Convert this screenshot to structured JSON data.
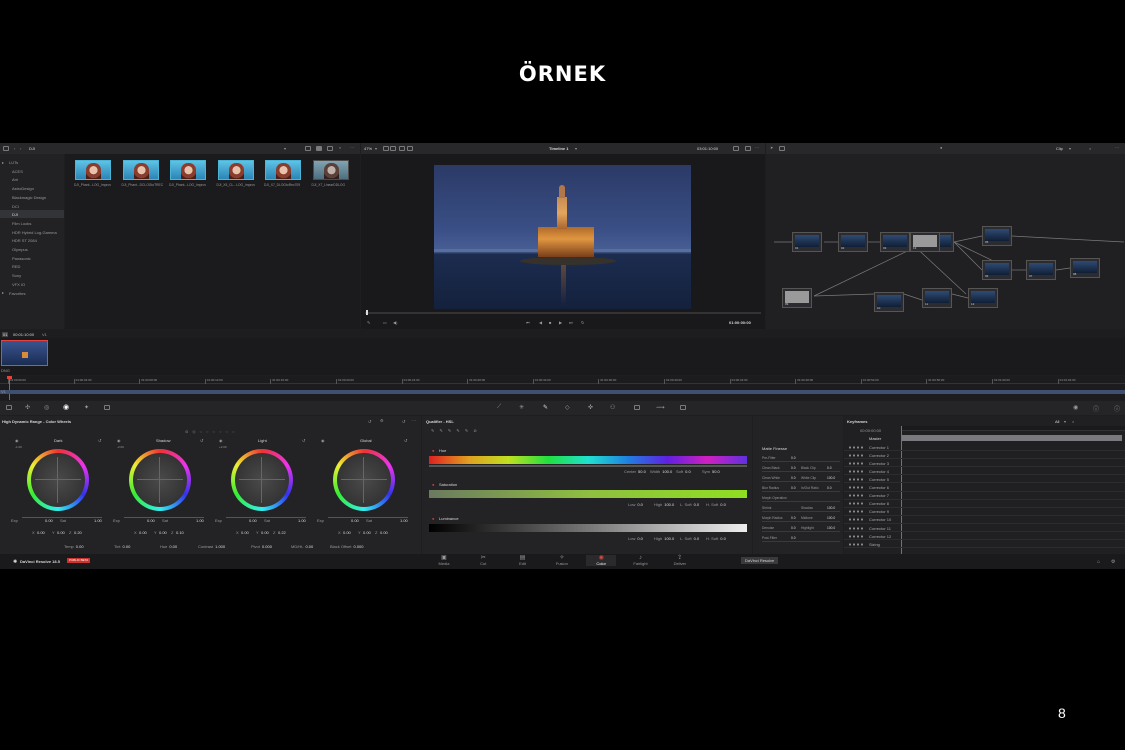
{
  "slide": {
    "title": "ÖRNEK",
    "page_number": "8"
  },
  "media_pool": {
    "path": "DJI",
    "tree": [
      {
        "label": "LUTs",
        "level": 0
      },
      {
        "label": "ACES",
        "level": 1
      },
      {
        "label": "Arri",
        "level": 1
      },
      {
        "label": "AstroDesign",
        "level": 1
      },
      {
        "label": "Blackmagic Design",
        "level": 1
      },
      {
        "label": "DCI",
        "level": 1
      },
      {
        "label": "DJI",
        "level": 1,
        "selected": true
      },
      {
        "label": "Film Looks",
        "level": 1
      },
      {
        "label": "HDR Hybrid Log-Gamma",
        "level": 1
      },
      {
        "label": "HDR ST 2084",
        "level": 1
      },
      {
        "label": "Olympus",
        "level": 1
      },
      {
        "label": "Panasonic",
        "level": 1
      },
      {
        "label": "RED",
        "level": 1
      },
      {
        "label": "Sony",
        "level": 1
      },
      {
        "label": "VFX IO",
        "level": 1
      },
      {
        "label": "Favorites",
        "level": 0
      }
    ],
    "thumbs": [
      "DJI_Phant...LOG_Improv",
      "DJI_Phant...DCLOGtoTREC",
      "DJI_Phant...LOG_Improv",
      "DJI_X5_CL...LOG_Improv",
      "DJI_X7_DLOGtoRec709",
      "DJI_X7_LinearDDLOG"
    ]
  },
  "viewer": {
    "zoom": "47%",
    "timeline_name": "Timeline 1",
    "timecode_top": "03:01:10:00",
    "timecode": "01:00:00:00"
  },
  "node_editor": {
    "mode": "Clip",
    "nodes": [
      "01",
      "02",
      "03",
      "04",
      "05",
      "06",
      "07",
      "08",
      "09",
      "10",
      "11",
      "12",
      "13"
    ]
  },
  "clips": {
    "clip_timecode": "00:01:10:00",
    "clip_label": "V1",
    "clip_format": "DNG"
  },
  "ruler": {
    "ticks": [
      "01:00:00:00",
      "01:00:04:00",
      "01:00:08:00",
      "01:00:12:00",
      "01:00:16:00",
      "01:00:20:00",
      "01:00:24:00",
      "01:00:28:00",
      "01:00:32:00",
      "01:00:36:00",
      "01:00:40:00",
      "01:00:44:00",
      "01:00:48:00",
      "01:00:52:00",
      "01:00:56:00",
      "01:01:00:00",
      "01:01:04:00"
    ]
  },
  "color_wheels": {
    "title": "High Dynamic Range - Color Wheels",
    "wheels": [
      {
        "name": "Dark",
        "exp": "0.00",
        "sat": "1.00",
        "x": "0.00",
        "y": "0.00",
        "z": "0.20",
        "ev": "-1.00"
      },
      {
        "name": "Shadow",
        "exp": "0.00",
        "sat": "1.00",
        "x": "0.00",
        "y": "0.00",
        "z": "0.10",
        "ev": "-2.00"
      },
      {
        "name": "Light",
        "exp": "0.00",
        "sat": "1.00",
        "x": "0.00",
        "y": "0.00",
        "z": "0.22",
        "ev": "+2.00"
      },
      {
        "name": "Global",
        "exp": "0.00",
        "sat": "1.00",
        "x": "0.00",
        "y": "0.00",
        "z": "0.00",
        "ev": ""
      }
    ],
    "labels": {
      "exp": "Exp",
      "sat": "Sat"
    },
    "bottom_fields": [
      {
        "label": "Temp",
        "value": "0.00"
      },
      {
        "label": "Tint",
        "value": "0.00"
      },
      {
        "label": "Hue",
        "value": "0.00"
      },
      {
        "label": "Contrast",
        "value": "1.000"
      },
      {
        "label": "Pivot",
        "value": "0.000"
      },
      {
        "label": "MD/HL",
        "value": "0.00"
      },
      {
        "label": "Black Offset",
        "value": "0.000"
      }
    ]
  },
  "qualifier": {
    "title": "Qualifier - HSL",
    "hue": {
      "label": "Hue",
      "center": "50.0",
      "width": "100.0",
      "soft": "0.0",
      "sym": "50.0"
    },
    "saturation": {
      "label": "Saturation",
      "low": "0.0",
      "high": "100.0",
      "lsoft": "0.0",
      "hsoft": "0.0"
    },
    "luminance": {
      "label": "Luminance",
      "low": "0.0",
      "high": "100.0",
      "lsoft": "0.0",
      "hsoft": "0.0"
    },
    "field_labels": {
      "center": "Center",
      "width": "Width",
      "soft": "Soft",
      "sym": "Sym",
      "low": "Low",
      "high": "High",
      "lsoft": "L. Soft",
      "hsoft": "H. Soft"
    }
  },
  "matte_finesse": {
    "title": "Matte Finesse",
    "rows": [
      {
        "label": "Pre-Filter",
        "value": "0.0"
      },
      {
        "label": "Clean Black",
        "value": "0.0",
        "label2": "Black Clip",
        "value2": "0.0"
      },
      {
        "label": "Clean White",
        "value": "0.0",
        "label2": "White Clip",
        "value2": "100.0"
      },
      {
        "label": "Blur Radius",
        "value": "0.0",
        "label2": "In/Out Ratio",
        "value2": "0.0"
      },
      {
        "label": "Morph Operation",
        "value": ""
      },
      {
        "label": "Shrink",
        "value": "",
        "label2": "Shadow",
        "value2": "100.0"
      },
      {
        "label": "Morph Radius",
        "value": "0.0",
        "label2": "Midtone",
        "value2": "100.0"
      },
      {
        "label": "Denoise",
        "value": "0.0",
        "label2": "Highlight",
        "value2": "100.0"
      },
      {
        "label": "Post-Filter",
        "value": "0.0"
      }
    ]
  },
  "keyframes": {
    "title": "Keyframes",
    "filter": "All",
    "timecode": "00:00:00:00",
    "master": "Master",
    "rows": [
      "Corrector 1",
      "Corrector 2",
      "Corrector 3",
      "Corrector 4",
      "Corrector 5",
      "Corrector 6",
      "Corrector 7",
      "Corrector 8",
      "Corrector 9",
      "Corrector 10",
      "Corrector 11",
      "Corrector 12",
      "Sizing"
    ]
  },
  "footer": {
    "app_name": "DaVinci Resolve 18.5",
    "badge": "PUBLIC BETA",
    "tooltip": "DaVinci Resolve",
    "tabs": [
      "Media",
      "Cut",
      "Edit",
      "Fusion",
      "Color",
      "Fairlight",
      "Deliver"
    ],
    "active_tab": "Color"
  }
}
